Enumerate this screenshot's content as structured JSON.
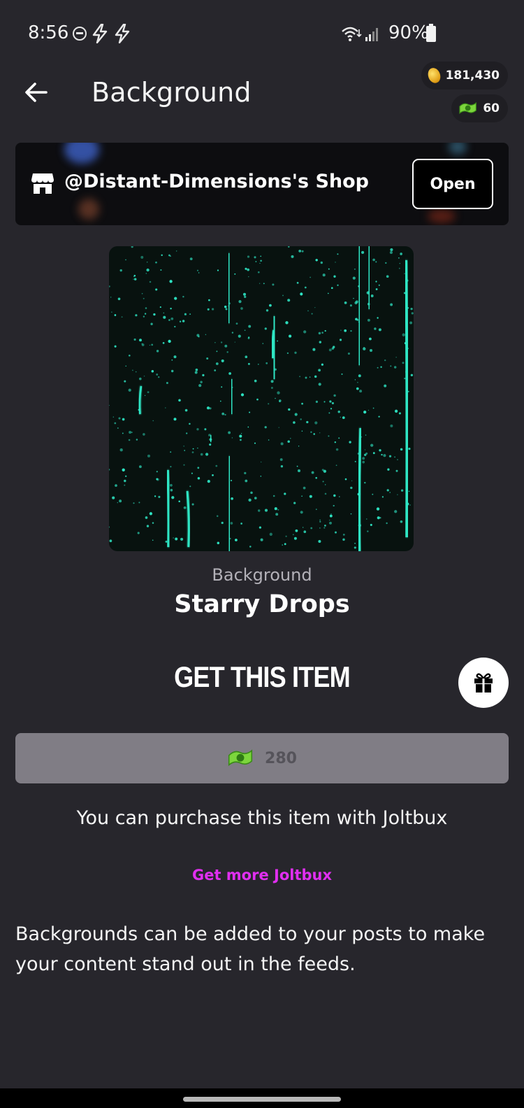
{
  "status_bar": {
    "time": "8:56",
    "battery": "90%"
  },
  "header": {
    "title": "Background"
  },
  "balances": {
    "coins": "181,430",
    "joltbux": "60"
  },
  "shop": {
    "name": "@Distant-Dimensions's Shop",
    "open_label": "Open"
  },
  "item": {
    "type": "Background",
    "name": "Starry Drops"
  },
  "purchase": {
    "heading": "GET THIS ITEM",
    "price": "280",
    "note": "You can purchase this item with Joltbux",
    "get_more_label": "Get more Joltbux"
  },
  "description": "Backgrounds can be added to your posts to make your content stand out in the feeds.",
  "icons": {
    "back": "arrow-left-icon",
    "shop": "storefront-icon",
    "gift": "gift-icon",
    "coin": "coin-icon",
    "joltbux": "joltbux-icon"
  },
  "colors": {
    "background": "#27262c",
    "accent_link": "#e02ff0",
    "price_button": "#807d85",
    "preview_glow": "#2ee6c4"
  }
}
